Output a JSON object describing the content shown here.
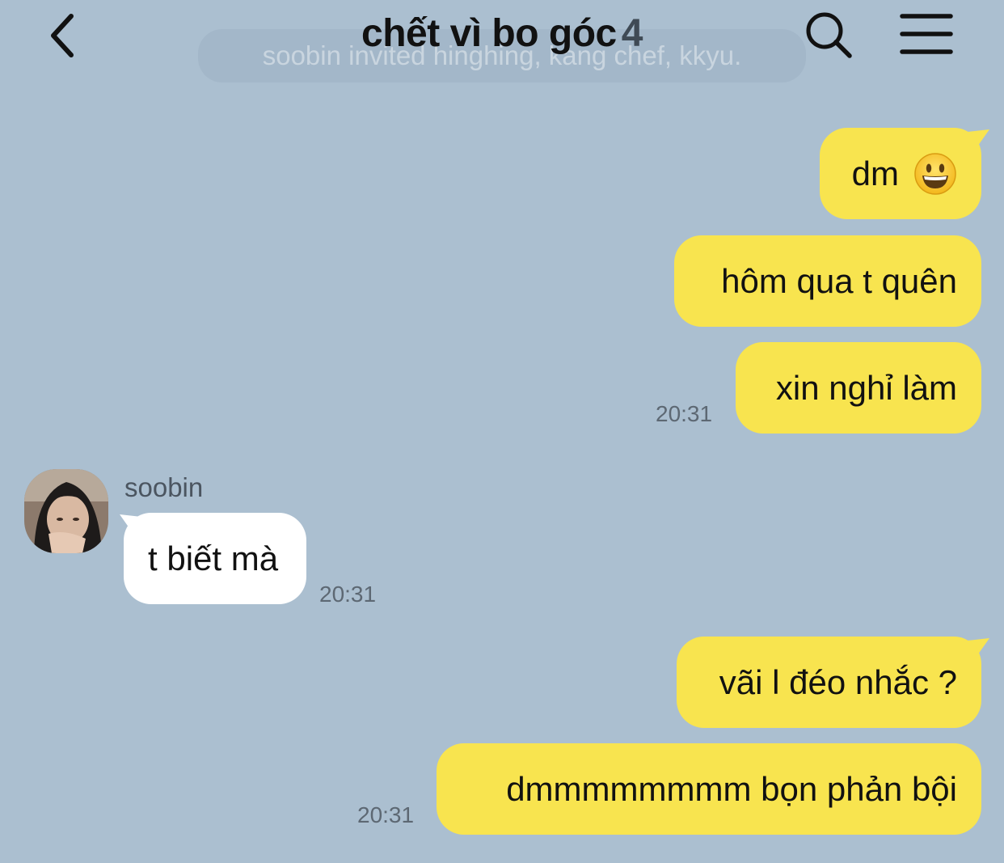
{
  "header": {
    "title": "chết vì bo góc",
    "member_count": "4",
    "system_notice": "soobin invited hinghing, kang chef, kkyu."
  },
  "messages": [
    {
      "direction": "out",
      "text": "dm",
      "emoji": "grinning-face-emoji"
    },
    {
      "direction": "out",
      "text": "hôm qua t quên"
    },
    {
      "direction": "out",
      "text": "xin nghỉ làm",
      "time": "20:31"
    },
    {
      "direction": "in",
      "sender": "soobin",
      "text": "t biết mà",
      "time": "20:31"
    },
    {
      "direction": "out",
      "text": "vãi l đéo nhắc ?"
    },
    {
      "direction": "out",
      "text": "dmmmmmmmm bọn phản bội",
      "time": "20:31"
    }
  ],
  "colors": {
    "background": "#abbfd0",
    "outgoing_bubble": "#f8e44f",
    "incoming_bubble": "#ffffff"
  },
  "icons": [
    "back-arrow-icon",
    "search-icon",
    "menu-icon",
    "grinning-face-emoji",
    "avatar"
  ]
}
